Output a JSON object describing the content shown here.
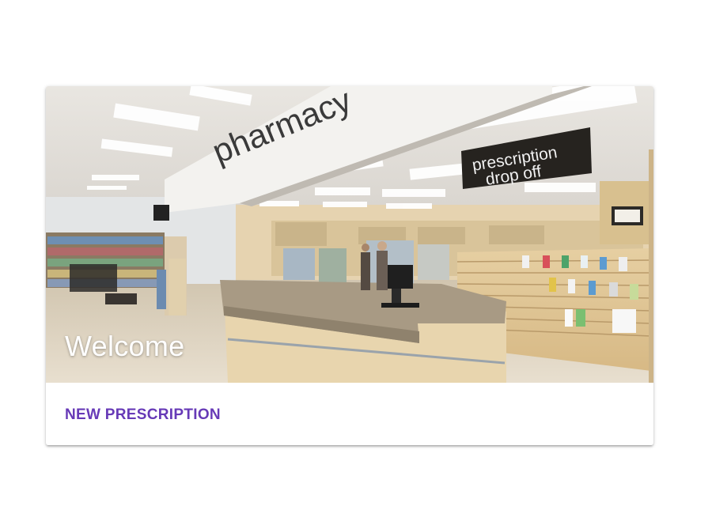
{
  "card": {
    "title": "Welcome",
    "action_label": "NEW PRESCRIPTION"
  },
  "photo": {
    "sign_pharmacy": "pharmacy",
    "sign_dropoff_line1": "prescription",
    "sign_dropoff_line2": "drop off"
  },
  "colors": {
    "accent": "#673ab7",
    "title_text": "#ffffff"
  }
}
